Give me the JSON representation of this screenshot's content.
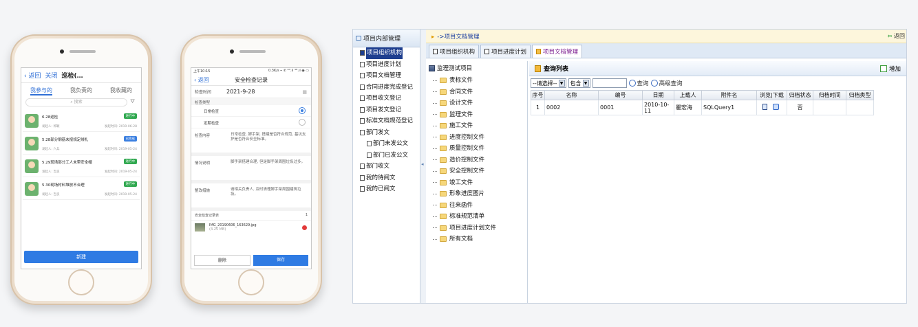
{
  "phone1": {
    "back": "返回",
    "close": "关闭",
    "title": "巡检(…",
    "tabs": [
      "我参与的",
      "我负责的",
      "我收藏的"
    ],
    "search_placeholder": "搜索",
    "items": [
      {
        "title": "6.28巡检",
        "person": "发起人: 郭颖",
        "date": "发起时间: 2019-06-28",
        "badge": "进行中"
      },
      {
        "title": "5.28部分钢筋未按规定绑扎",
        "person": "发起人: 六兵",
        "date": "发起时间: 2019-05-24",
        "badge": "已完成"
      },
      {
        "title": "5.29现场部分工人未带安全帽",
        "person": "发起人: 吉良",
        "date": "发起时间: 2019-05-24",
        "badge": "进行中"
      },
      {
        "title": "5.30现场材料堆放不合理",
        "person": "发起人: 吉良",
        "date": "发起时间: 2019-05-24",
        "badge": "进行中"
      }
    ],
    "new_button": "新建"
  },
  "phone2": {
    "status_time": "上午10:15",
    "status_right": "0.3K/s ⌁ ✆ ⁴ᴳ.ıl ⁴ᴳ.ıl ◉ ▭",
    "back": "返回",
    "title": "安全检查记录",
    "check_time_label": "检查时间",
    "check_time_value": "2021-9-28",
    "type_label": "检查类型",
    "type_options": [
      "日常检查",
      "定期检查"
    ],
    "content_label": "检查内容",
    "content_value": "日常检查, 脚手架, 搭建是否符合规范, 基坑支护是否符合安全标准。",
    "situation_label": "情况说明",
    "situation_value": "脚手架搭建合理, 但是脚手架周围垃圾过多。",
    "rectify_label": "整改措施",
    "rectify_value": "请相关负责人, 及时清理脚手架周围建筑垃圾。",
    "attach_label": "安全检查记录表",
    "attach_count": "1",
    "file_name": "IMG_20190606_163629.jpg",
    "file_size": "(4.25 MB)",
    "delete_button": "删除",
    "save_button": "保存"
  },
  "desktop": {
    "left_title": "项目内部管理",
    "left_items": [
      {
        "label": "项目组织机构",
        "active": true,
        "sub": false
      },
      {
        "label": "项目进度计划",
        "active": false,
        "sub": false
      },
      {
        "label": "项目文档管理",
        "active": false,
        "sub": false
      },
      {
        "label": "合同进度完成登记",
        "active": false,
        "sub": false
      },
      {
        "label": "项目收文登记",
        "active": false,
        "sub": false
      },
      {
        "label": "项目发文登记",
        "active": false,
        "sub": false
      },
      {
        "label": "标准文档规范登记",
        "active": false,
        "sub": false
      },
      {
        "label": "部门发文",
        "active": false,
        "sub": false
      },
      {
        "label": "部门未发公文",
        "active": false,
        "sub": true
      },
      {
        "label": "部门已发公文",
        "active": false,
        "sub": true
      },
      {
        "label": "部门收文",
        "active": false,
        "sub": false
      },
      {
        "label": "我的待阅文",
        "active": false,
        "sub": false
      },
      {
        "label": "我的已阅文",
        "active": false,
        "sub": false
      }
    ],
    "breadcrumb": "->项目文档管理",
    "back": "返回",
    "tabs": [
      "项目组织机构",
      "项目进度计划",
      "项目文档管理"
    ],
    "tree_root": "监理测试项目",
    "tree_items": [
      "责标文件",
      "合同文件",
      "设计文件",
      "监理文件",
      "施工文件",
      "进度控制文件",
      "质量控制文件",
      "造价控制文件",
      "安全控制文件",
      "竣工文件",
      "形象进度图片",
      "往来函件",
      "标准规范清单",
      "项目进度计划文件",
      "所有文档"
    ],
    "list_title": "查询列表",
    "add_button": "增加",
    "select_placeholder": "--请选择--",
    "select_op": "包含",
    "search_button": "查询",
    "advanced_button": "高级查询",
    "columns": [
      "序号",
      "名称",
      "编号",
      "日期",
      "上载人",
      "附件名",
      "浏览|下载",
      "归档状态",
      "归档时间",
      "归档类型"
    ],
    "rows": [
      {
        "no": "1",
        "name": "0002",
        "code": "0001",
        "date": "2010-10-11",
        "uploader": "瞿宏海",
        "attachment": "SQLQuery1",
        "archived": "否",
        "archive_time": "",
        "archive_type": ""
      }
    ]
  }
}
